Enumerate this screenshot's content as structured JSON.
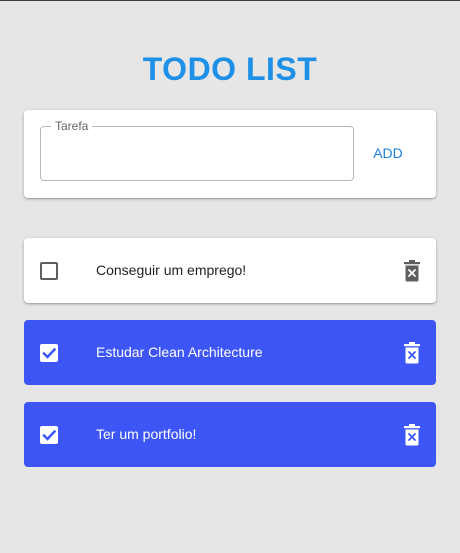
{
  "app": {
    "title": "TODO LIST",
    "accent_color": "#1e90e8",
    "done_color": "#3d55f5"
  },
  "form": {
    "label": "Tarefa",
    "value": "",
    "add_label": "ADD"
  },
  "tasks": [
    {
      "text": "Conseguir um emprego!",
      "done": false,
      "delete_icon": "trash-icon"
    },
    {
      "text": "Estudar Clean Architecture",
      "done": true,
      "delete_icon": "trash-icon"
    },
    {
      "text": "Ter um portfolio!",
      "done": true,
      "delete_icon": "trash-icon"
    }
  ]
}
